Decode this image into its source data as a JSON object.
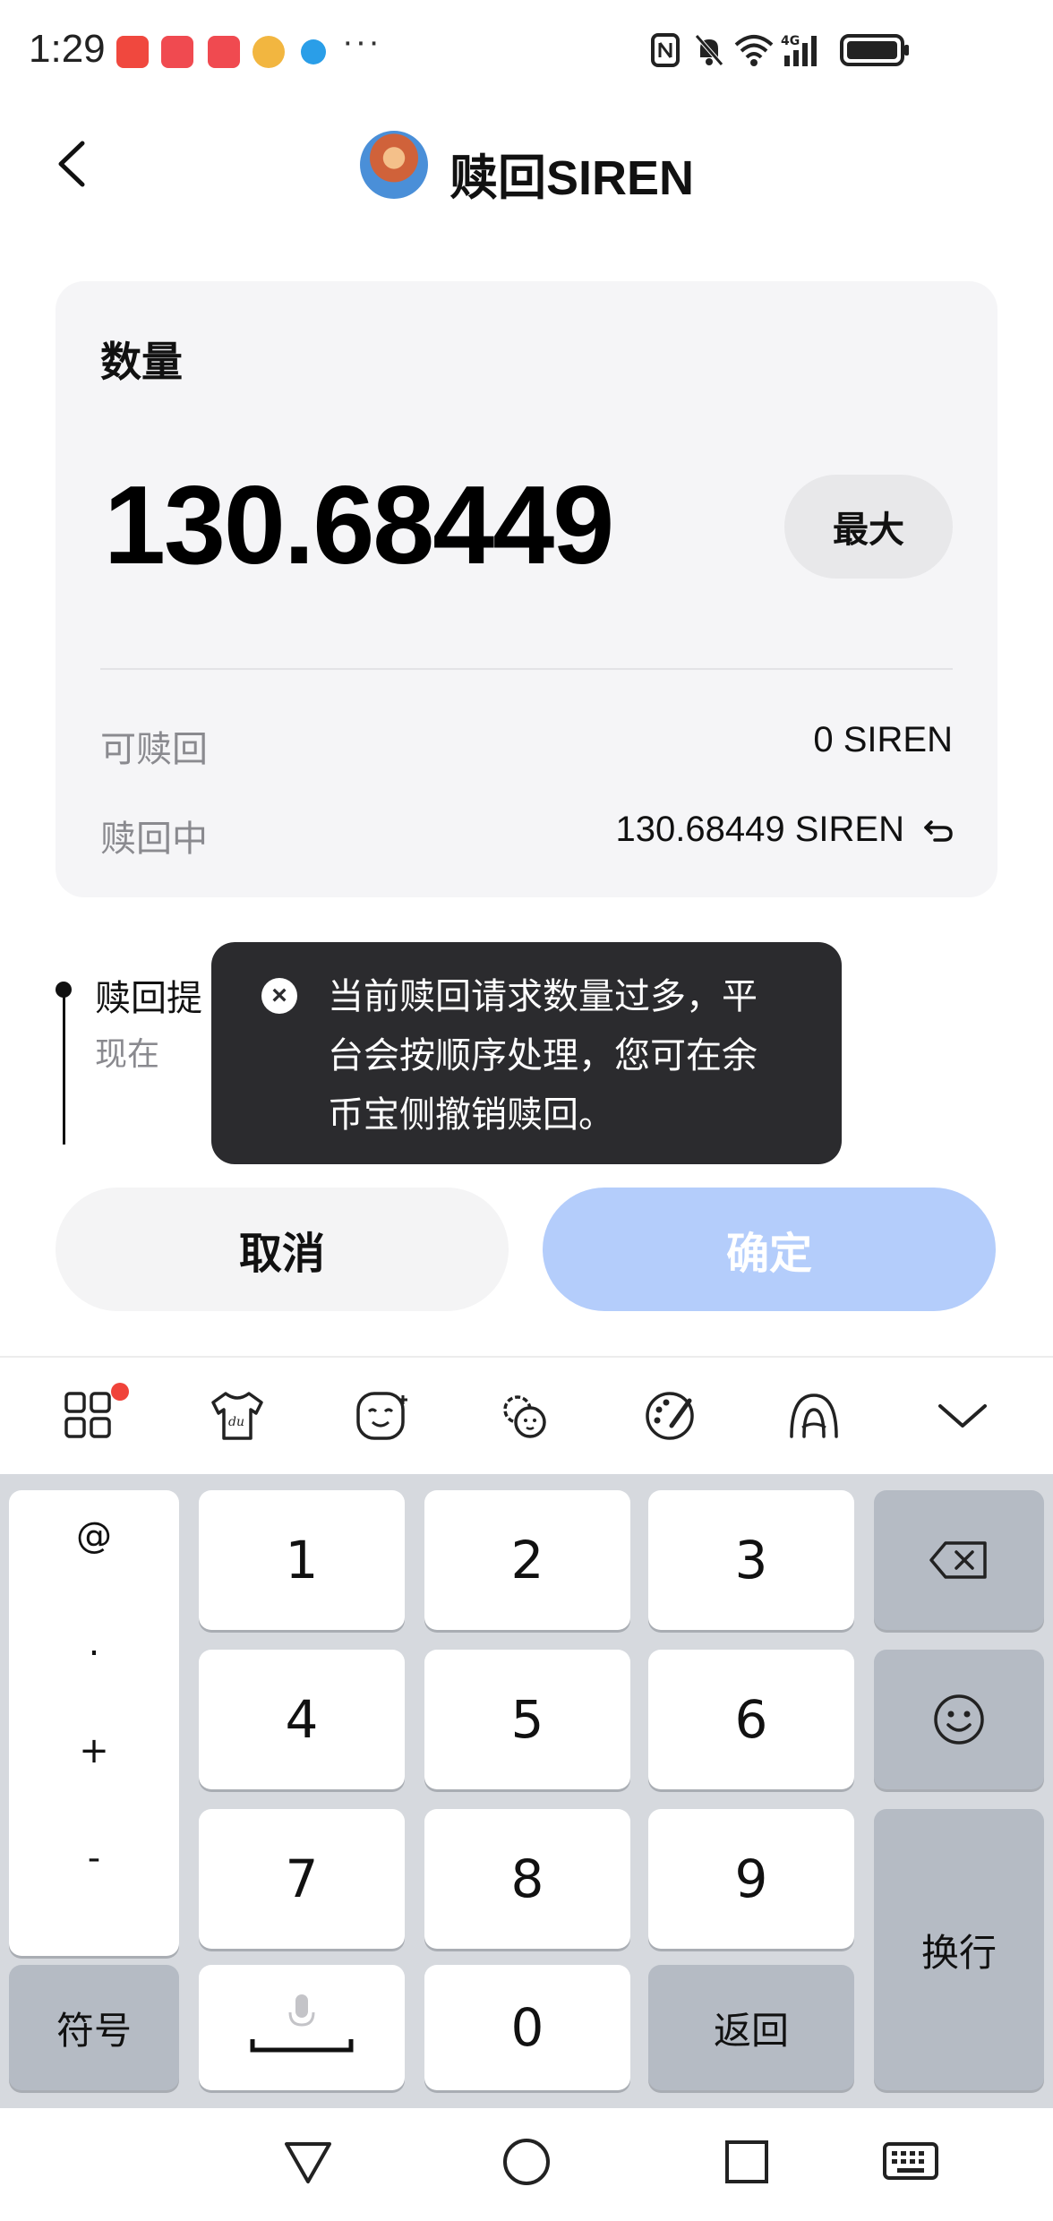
{
  "status_bar": {
    "time": "1:29",
    "more": "···",
    "app_icons": [
      "app-icon-red",
      "huawei-icon",
      "huawei-icon",
      "game-icon",
      "browser-icon"
    ],
    "system_icons": [
      "nfc-icon",
      "mute-icon",
      "wifi-icon",
      "4g-signal-icon",
      "battery-icon"
    ]
  },
  "header": {
    "title": "赎回SIREN",
    "back_icon": "back-arrow-icon"
  },
  "card": {
    "label": "数量",
    "amount": "130.68449",
    "max_label": "最大",
    "redeemable_label": "可赎回",
    "redeemable_value": "0 SIREN",
    "redeeming_label": "赎回中",
    "redeeming_value": "130.68449 SIREN"
  },
  "timeline": {
    "title": "赎回提",
    "subtitle": "现在"
  },
  "toast": {
    "line1": "当前赎回请求数量过多，平",
    "line2": "台会按顺序处理，您可在余",
    "line3": "币宝侧撤销赎回。"
  },
  "buttons": {
    "cancel": "取消",
    "confirm": "确定"
  },
  "keyboard": {
    "symbols": [
      "@",
      ".",
      "+",
      "-"
    ],
    "digits": [
      "1",
      "2",
      "3",
      "4",
      "5",
      "6",
      "7",
      "8",
      "9",
      "0"
    ],
    "symbol_key": "符号",
    "return_key": "返回",
    "newline_key": "换行"
  },
  "colors": {
    "accent_disabled": "#b4cdfb",
    "toast_bg": "#2b2b2e",
    "badge": "#f0433a"
  }
}
